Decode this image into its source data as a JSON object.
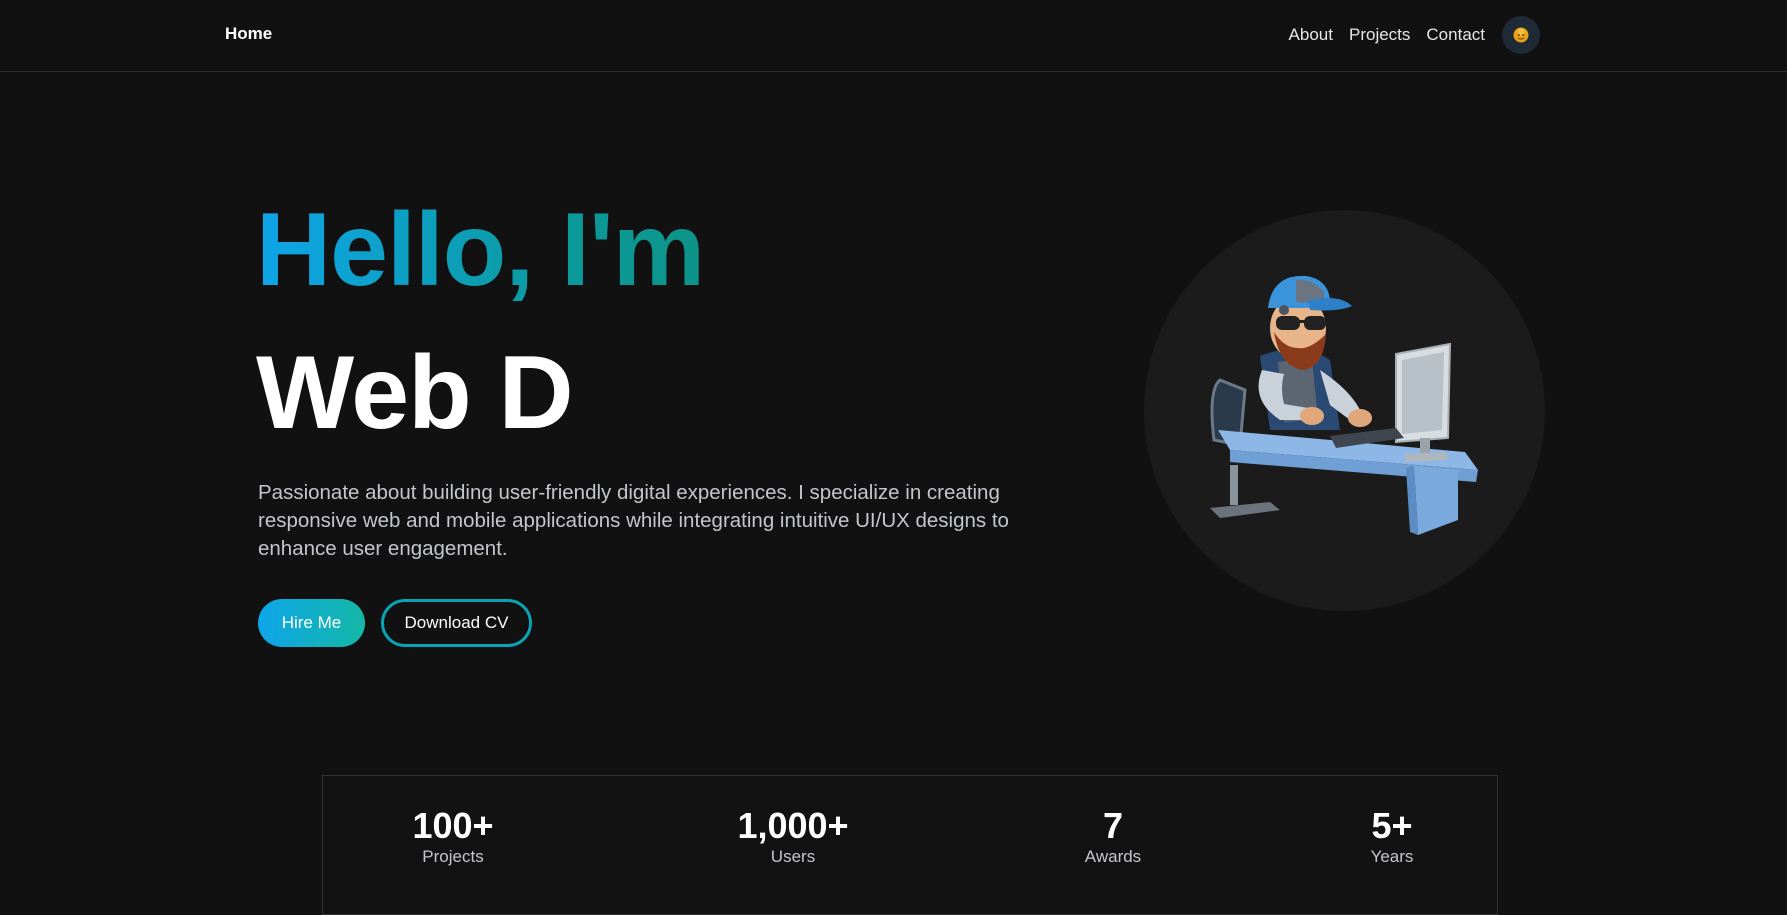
{
  "nav": {
    "home_label": "Home",
    "links": [
      {
        "label": "About"
      },
      {
        "label": "Projects"
      },
      {
        "label": "Contact"
      }
    ],
    "avatar_icon": "avatar-icon"
  },
  "hero": {
    "title_line1": "Hello, I'm",
    "title_line2": "Web D",
    "description": "Passionate about building user-friendly digital experiences. I specialize in creating responsive web and mobile applications while integrating intuitive UI/UX designs to enhance user engagement.",
    "hire_button": "Hire Me",
    "cv_button": "Download CV",
    "illustration_icon": "developer-at-desk-illustration"
  },
  "stats": [
    {
      "value": "100+",
      "label": "Projects"
    },
    {
      "value": "1,000+",
      "label": "Users"
    },
    {
      "value": "7",
      "label": "Awards"
    },
    {
      "value": "5+",
      "label": "Years"
    }
  ],
  "colors": {
    "background": "#111111",
    "accent_blue": "#0ea5e9",
    "accent_teal": "#14b8a6",
    "text_muted": "#c4c6cc"
  }
}
